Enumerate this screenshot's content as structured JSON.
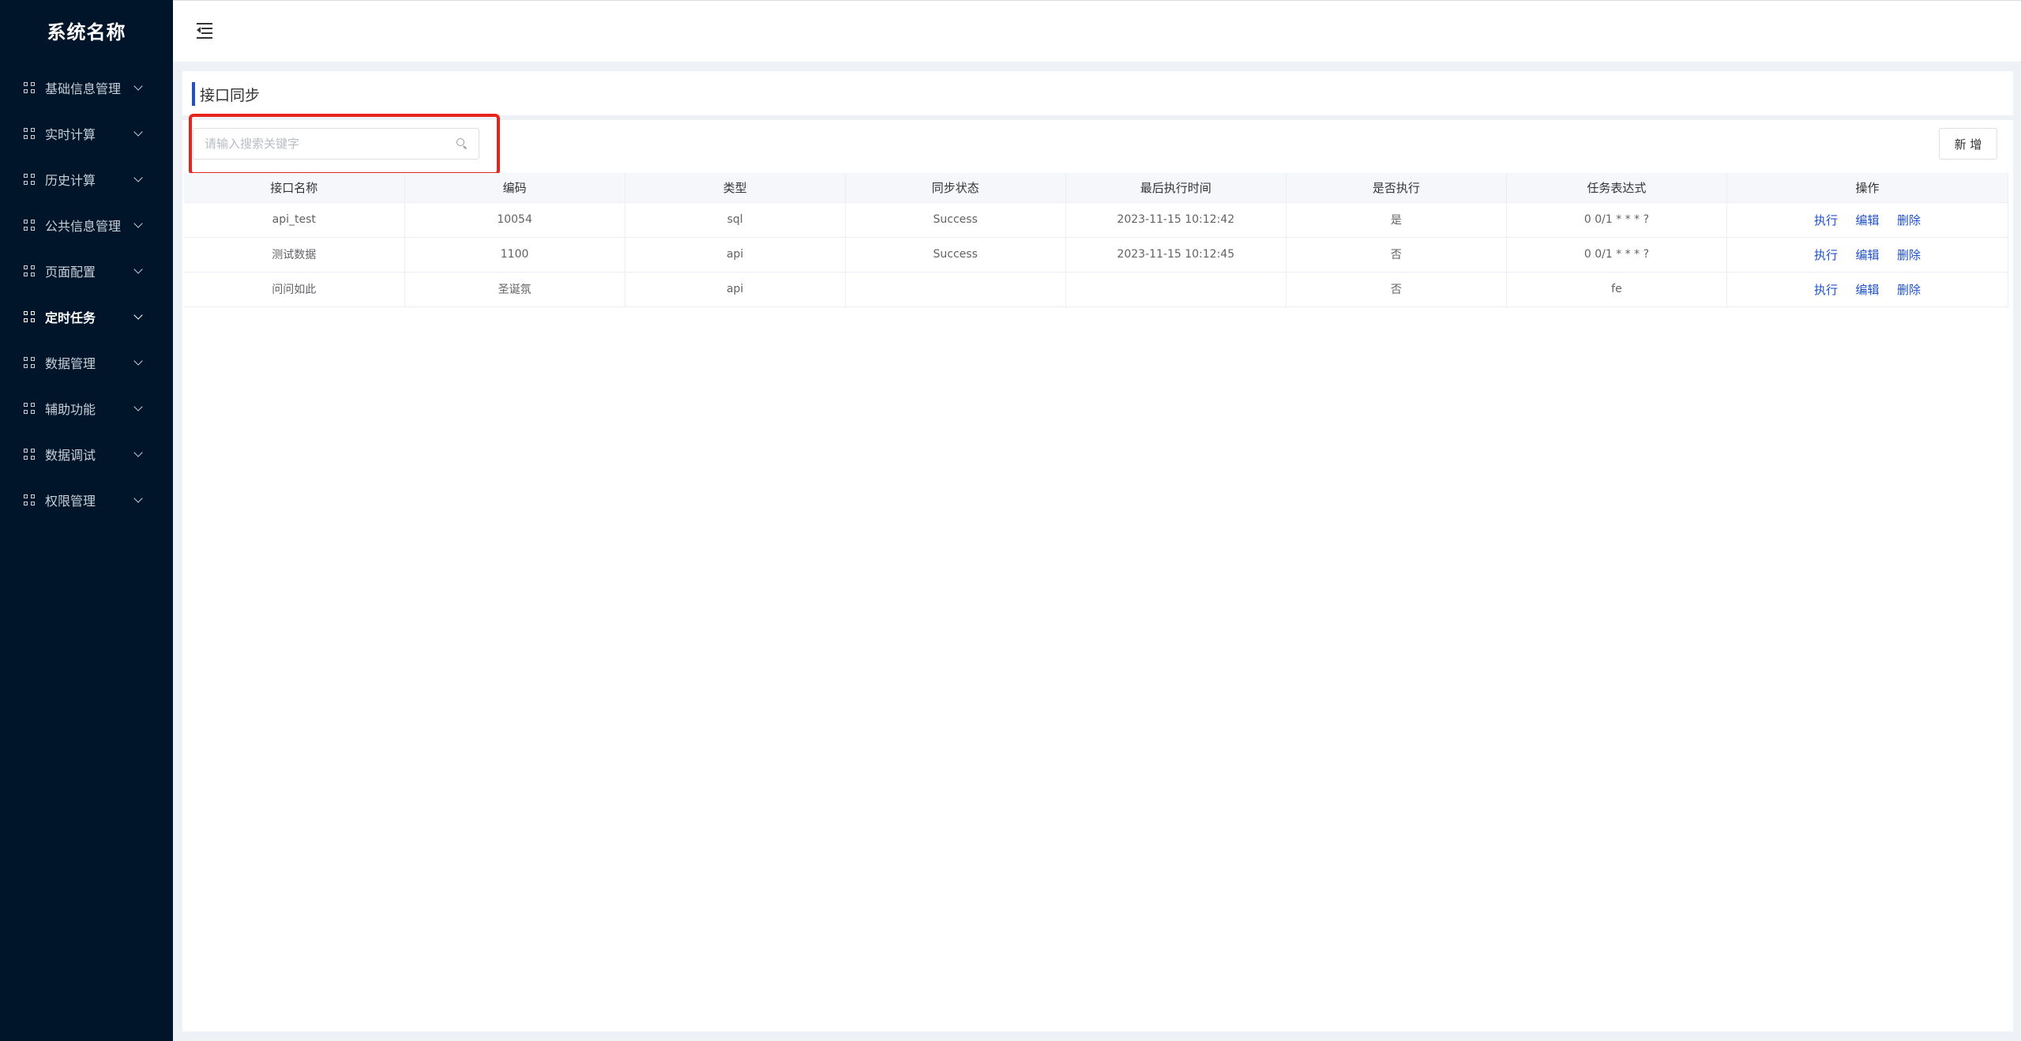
{
  "sidebar": {
    "title": "系统名称",
    "items": [
      {
        "label": "基础信息管理",
        "active": false
      },
      {
        "label": "实时计算",
        "active": false
      },
      {
        "label": "历史计算",
        "active": false
      },
      {
        "label": "公共信息管理",
        "active": false
      },
      {
        "label": "页面配置",
        "active": false
      },
      {
        "label": "定时任务",
        "active": true
      },
      {
        "label": "数据管理",
        "active": false
      },
      {
        "label": "辅助功能",
        "active": false
      },
      {
        "label": "数据调试",
        "active": false
      },
      {
        "label": "权限管理",
        "active": false
      }
    ]
  },
  "page": {
    "title": "接口同步"
  },
  "search": {
    "placeholder": "请输入搜索关键字",
    "value": ""
  },
  "toolbar": {
    "add_label": "新 增"
  },
  "table": {
    "headers": [
      "接口名称",
      "编码",
      "类型",
      "同步状态",
      "最后执行时间",
      "是否执行",
      "任务表达式",
      "操作"
    ],
    "rows": [
      {
        "name": "api_test",
        "code": "10054",
        "type": "sql",
        "status": "Success",
        "last_run": "2023-11-15 10:12:42",
        "enabled": "是",
        "cron": "0 0/1 * * * ?"
      },
      {
        "name": "测试数据",
        "code": "1100",
        "type": "api",
        "status": "Success",
        "last_run": "2023-11-15 10:12:45",
        "enabled": "否",
        "cron": "0 0/1 * * * ?"
      },
      {
        "name": "问问如此",
        "code": "圣诞氛",
        "type": "api",
        "status": "",
        "last_run": "",
        "enabled": "否",
        "cron": "fe"
      }
    ],
    "actions": {
      "execute": "执行",
      "edit": "编辑",
      "delete": "删除"
    }
  },
  "colors": {
    "sidebar_bg": "#001529",
    "accent": "#1f50c8",
    "highlight": "#e8231c",
    "page_bg": "#eef1f6"
  }
}
